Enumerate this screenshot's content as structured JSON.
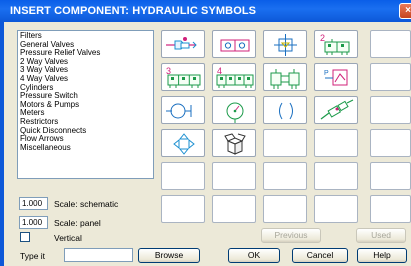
{
  "window": {
    "title": "INSERT COMPONENT: HYDRAULIC SYMBOLS",
    "close_glyph": "×"
  },
  "categories": [
    "Filters",
    "General Valves",
    "Pressure Relief Valves",
    "2 Way Valves",
    "3 Way Valves",
    "4 Way Valves",
    "Cylinders",
    "Pressure Switch",
    "Motors & Pumps",
    "Meters",
    "Restrictors",
    "Quick Disconnects",
    "Flow Arrows",
    "Miscellaneous"
  ],
  "symbols": [
    {
      "icon": "filter-valve-icon"
    },
    {
      "icon": "two-way-valve-icon"
    },
    {
      "icon": "check-valve-box-icon"
    },
    {
      "icon": "two-position-valve-icon",
      "label": "2"
    },
    {
      "icon": "empty"
    },
    {
      "icon": "three-position-valve-icon",
      "label": "3"
    },
    {
      "icon": "four-way-valve-icon",
      "label": "4"
    },
    {
      "icon": "cylinder-assembly-icon"
    },
    {
      "icon": "pressure-switch-icon"
    },
    {
      "icon": "empty"
    },
    {
      "icon": "cylinder-icon"
    },
    {
      "icon": "gauge-icon"
    },
    {
      "icon": "restrictor-icon"
    },
    {
      "icon": "quick-disconnect-icon"
    },
    {
      "icon": "empty"
    },
    {
      "icon": "flow-arrows-icon"
    },
    {
      "icon": "box-icon"
    }
  ],
  "scale": {
    "schematic_value": "1.000",
    "schematic_label": "Scale: schematic",
    "panel_value": "1.000",
    "panel_label": "Scale: panel",
    "vertical_label": "Vertical",
    "vertical_checked": false
  },
  "typeit": {
    "label": "Type it",
    "value": ""
  },
  "buttons": {
    "browse": "Browse",
    "ok": "OK",
    "cancel": "Cancel",
    "help": "Help",
    "previous": "Previous",
    "used": "Used"
  }
}
